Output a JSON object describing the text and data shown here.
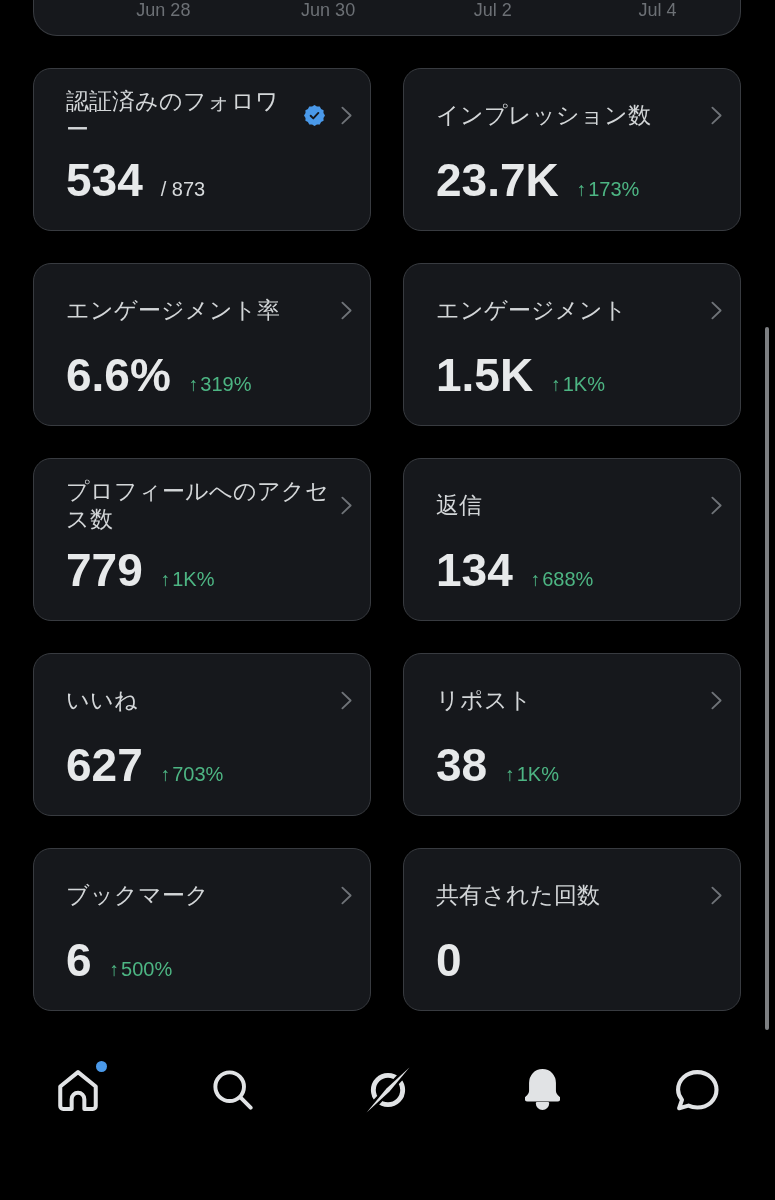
{
  "chart": {
    "x_labels": [
      "Jun 28",
      "Jun 30",
      "Jul 2",
      "Jul 4"
    ]
  },
  "cards": [
    {
      "title": "認証済みのフォロワー",
      "value": "534",
      "total": "/ 873",
      "verified": true
    },
    {
      "title": "インプレッション数",
      "value": "23.7K",
      "verified": false,
      "change": {
        "arrow": "↑",
        "text": "173%"
      }
    },
    {
      "title": "エンゲージメント率",
      "value": "6.6%",
      "verified": false,
      "change": {
        "arrow": "↑",
        "text": "319%"
      }
    },
    {
      "title": "エンゲージメント",
      "value": "1.5K",
      "verified": false,
      "change": {
        "arrow": "↑",
        "text": "1K%"
      }
    },
    {
      "title": "プロフィールへのアクセス数",
      "value": "779",
      "verified": false,
      "change": {
        "arrow": "↑",
        "text": "1K%"
      }
    },
    {
      "title": "返信",
      "value": "134",
      "verified": false,
      "change": {
        "arrow": "↑",
        "text": "688%"
      }
    },
    {
      "title": "いいね",
      "value": "627",
      "verified": false,
      "change": {
        "arrow": "↑",
        "text": "703%"
      }
    },
    {
      "title": "リポスト",
      "value": "38",
      "verified": false,
      "change": {
        "arrow": "↑",
        "text": "1K%"
      }
    },
    {
      "title": "ブックマーク",
      "value": "6",
      "verified": false,
      "change": {
        "arrow": "↑",
        "text": "500%"
      }
    },
    {
      "title": "共有された回数",
      "value": "0",
      "verified": false
    }
  ],
  "nav": [
    {
      "kind": "home",
      "selected": false,
      "dot": true
    },
    {
      "kind": "search",
      "selected": false,
      "dot": false
    },
    {
      "kind": "assistant",
      "selected": false,
      "dot": false
    },
    {
      "kind": "notifications",
      "selected": true,
      "dot": false
    },
    {
      "kind": "messages",
      "selected": false,
      "dot": false
    }
  ]
}
